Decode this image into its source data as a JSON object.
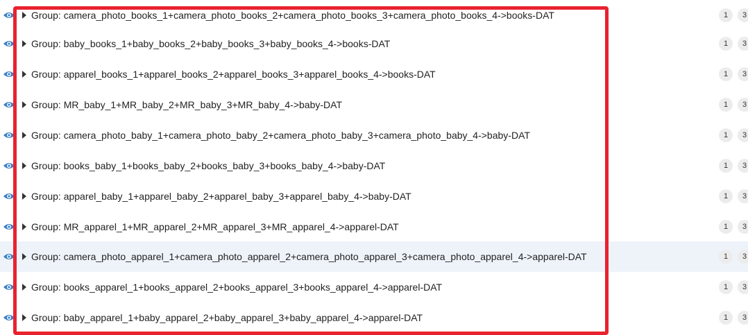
{
  "groups": [
    {
      "label": "Group: camera_photo_books_1+camera_photo_books_2+camera_photo_books_3+camera_photo_books_4->books-DAT",
      "count1": "1",
      "count2": "3"
    },
    {
      "label": "Group: baby_books_1+baby_books_2+baby_books_3+baby_books_4->books-DAT",
      "count1": "1",
      "count2": "3"
    },
    {
      "label": "Group: apparel_books_1+apparel_books_2+apparel_books_3+apparel_books_4->books-DAT",
      "count1": "1",
      "count2": "3"
    },
    {
      "label": "Group: MR_baby_1+MR_baby_2+MR_baby_3+MR_baby_4->baby-DAT",
      "count1": "1",
      "count2": "3"
    },
    {
      "label": "Group: camera_photo_baby_1+camera_photo_baby_2+camera_photo_baby_3+camera_photo_baby_4->baby-DAT",
      "count1": "1",
      "count2": "3"
    },
    {
      "label": "Group: books_baby_1+books_baby_2+books_baby_3+books_baby_4->baby-DAT",
      "count1": "1",
      "count2": "3"
    },
    {
      "label": "Group: apparel_baby_1+apparel_baby_2+apparel_baby_3+apparel_baby_4->baby-DAT",
      "count1": "1",
      "count2": "3"
    },
    {
      "label": "Group: MR_apparel_1+MR_apparel_2+MR_apparel_3+MR_apparel_4->apparel-DAT",
      "count1": "1",
      "count2": "3"
    },
    {
      "label": "Group: camera_photo_apparel_1+camera_photo_apparel_2+camera_photo_apparel_3+camera_photo_apparel_4->apparel-DAT",
      "count1": "1",
      "count2": "3",
      "highlighted": true
    },
    {
      "label": "Group: books_apparel_1+books_apparel_2+books_apparel_3+books_apparel_4->apparel-DAT",
      "count1": "1",
      "count2": "3"
    },
    {
      "label": "Group: baby_apparel_1+baby_apparel_2+baby_apparel_3+baby_apparel_4->apparel-DAT",
      "count1": "1",
      "count2": "3"
    }
  ],
  "icons": {
    "visibility": "eye-icon",
    "expand": "caret-right-icon"
  },
  "colors": {
    "eye": "#3b7fc4",
    "highlight_row": "#eef3fa",
    "annotation_box": "#e8232f",
    "badge_bg": "#ececec"
  }
}
